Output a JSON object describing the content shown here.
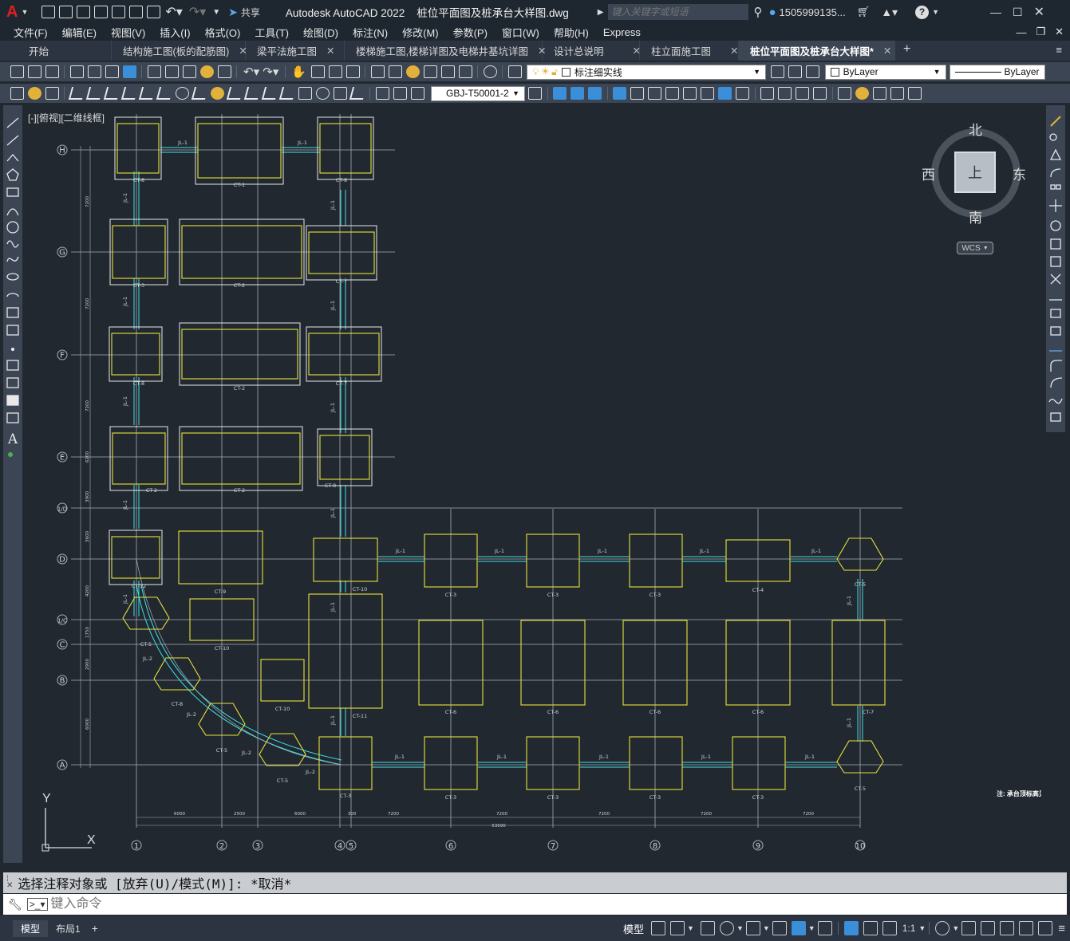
{
  "app": {
    "title": "Autodesk AutoCAD 2022    桩位平面图及桩承台大样图.dwg",
    "share": "共享",
    "search_placeholder": "键入关键字或短语",
    "user": "1505999135...",
    "logo": "A"
  },
  "menu": [
    "文件(F)",
    "编辑(E)",
    "视图(V)",
    "插入(I)",
    "格式(O)",
    "工具(T)",
    "绘图(D)",
    "标注(N)",
    "修改(M)",
    "参数(P)",
    "窗口(W)",
    "帮助(H)",
    "Express"
  ],
  "tabs": [
    {
      "label": "开始",
      "close": false
    },
    {
      "label": "结构施工图(板的配筋图)",
      "close": true
    },
    {
      "label": "梁平法施工图",
      "close": true
    },
    {
      "label": "楼梯施工图,楼梯详图及电梯井基坑详图",
      "close": true
    },
    {
      "label": "设计总说明",
      "close": true
    },
    {
      "label": "柱立面施工图",
      "close": true
    },
    {
      "label": "桩位平面图及桩承台大样图*",
      "close": true,
      "active": true
    }
  ],
  "toolbar": {
    "layer": "标注细实线",
    "color": "ByLayer",
    "linetype": "ByLayer",
    "dimstyle": "GBJ-T50001-2"
  },
  "viewport": {
    "label": "[-][俯视][二维线框]",
    "compass": {
      "n": "北",
      "s": "南",
      "e": "东",
      "w": "西",
      "top": "上",
      "wcs": "WCS"
    },
    "ucs": {
      "x": "X",
      "y": "Y"
    }
  },
  "command": {
    "history": "选择注释对象或 [放弃(U)/模式(M)]: *取消*",
    "placeholder": "键入命令"
  },
  "layouts": [
    "模型",
    "布局1"
  ],
  "status": {
    "model": "模型",
    "scale": "1:1"
  },
  "drawing": {
    "rows": [
      "H",
      "G",
      "F",
      "E",
      "1/D",
      "D",
      "1/C",
      "C",
      "B",
      "A"
    ],
    "cols": [
      "1",
      "2",
      "3",
      "4",
      "5",
      "6",
      "7",
      "8",
      "9",
      "10"
    ],
    "dims_bottom": [
      "6000",
      "2500",
      "6000",
      "300",
      "7200",
      "7200",
      "7200",
      "7200",
      "7200",
      "53690"
    ],
    "dims_left": [
      "7200",
      "7200",
      "7200",
      "6200",
      "3900",
      "3600",
      "4200",
      "1750",
      "2900",
      "6000"
    ],
    "cap_labels": [
      "CT-8",
      "CT-1",
      "CT-8",
      "CT-3",
      "CT-2",
      "CT-7",
      "CT-8",
      "CT-2",
      "CT-7",
      "CT-2",
      "CT-2",
      "CT-8",
      "CT-12",
      "CT-9",
      "CT-10",
      "CT-3",
      "CT-3",
      "CT-3",
      "CT-4",
      "CT-5",
      "CT-10",
      "CT-6",
      "CT-6",
      "CT-6",
      "CT-6",
      "CT-7",
      "CT-5",
      "CT-8",
      "CT-11",
      "CT-5",
      "CT-5",
      "CT-3",
      "CT-3",
      "CT-3",
      "CT-3",
      "CT-3",
      "CT-5"
    ],
    "beam_label": "JL-1",
    "beam_label2": "JL-2",
    "note": "注: 承台顶标高见图"
  }
}
